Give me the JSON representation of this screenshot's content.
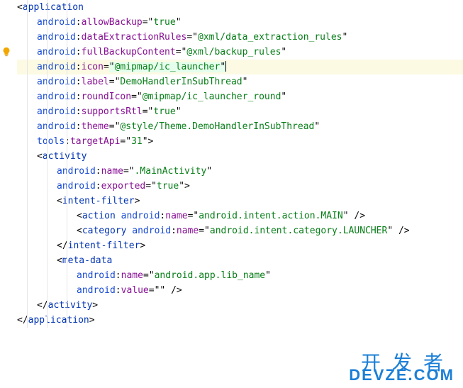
{
  "gutter": {
    "bulb_line_index": 3,
    "bulb_icon": "lightbulb-icon"
  },
  "highlighted_line_index": 3,
  "watermark": {
    "line1": "开发者",
    "line2": "DEVZE.COM"
  },
  "code_lines": [
    {
      "indent": 1,
      "tokens": [
        {
          "t": "punct",
          "v": "<"
        },
        {
          "t": "tag",
          "v": "application"
        }
      ]
    },
    {
      "indent": 2,
      "tokens": [
        {
          "t": "ns",
          "v": "android"
        },
        {
          "t": "punct",
          "v": ":"
        },
        {
          "t": "attr",
          "v": "allowBackup"
        },
        {
          "t": "punct",
          "v": "=\""
        },
        {
          "t": "str",
          "v": "true"
        },
        {
          "t": "punct",
          "v": "\""
        }
      ]
    },
    {
      "indent": 2,
      "tokens": [
        {
          "t": "ns",
          "v": "android"
        },
        {
          "t": "punct",
          "v": ":"
        },
        {
          "t": "attr",
          "v": "dataExtractionRules"
        },
        {
          "t": "punct",
          "v": "=\""
        },
        {
          "t": "str",
          "v": "@xml/data_extraction_rules"
        },
        {
          "t": "punct",
          "v": "\""
        }
      ]
    },
    {
      "indent": 2,
      "tokens": [
        {
          "t": "ns",
          "v": "android"
        },
        {
          "t": "punct",
          "v": ":"
        },
        {
          "t": "attr",
          "v": "fullBackupContent"
        },
        {
          "t": "punct",
          "v": "=\""
        },
        {
          "t": "str",
          "v": "@xml/backup_rules"
        },
        {
          "t": "punct",
          "v": "\""
        }
      ]
    },
    {
      "indent": 2,
      "highlight": true,
      "tokens": [
        {
          "t": "ns",
          "v": "android"
        },
        {
          "t": "punct",
          "v": ":"
        },
        {
          "t": "attr",
          "v": "icon"
        },
        {
          "t": "punct",
          "v": "="
        },
        {
          "t": "punct",
          "hl": true,
          "v": "\""
        },
        {
          "t": "str",
          "hl": true,
          "v": "@mipmap/ic_launcher"
        },
        {
          "t": "punct",
          "hl": true,
          "v": "\""
        },
        {
          "t": "caret",
          "v": ""
        }
      ]
    },
    {
      "indent": 2,
      "tokens": [
        {
          "t": "ns",
          "v": "android"
        },
        {
          "t": "punct",
          "v": ":"
        },
        {
          "t": "attr",
          "v": "label"
        },
        {
          "t": "punct",
          "v": "=\""
        },
        {
          "t": "str",
          "v": "DemoHandlerInSubThread"
        },
        {
          "t": "punct",
          "v": "\""
        }
      ]
    },
    {
      "indent": 2,
      "tokens": [
        {
          "t": "ns",
          "v": "android"
        },
        {
          "t": "punct",
          "v": ":"
        },
        {
          "t": "attr",
          "v": "roundIcon"
        },
        {
          "t": "punct",
          "v": "=\""
        },
        {
          "t": "str",
          "v": "@mipmap/ic_launcher_round"
        },
        {
          "t": "punct",
          "v": "\""
        }
      ]
    },
    {
      "indent": 2,
      "tokens": [
        {
          "t": "ns",
          "v": "android"
        },
        {
          "t": "punct",
          "v": ":"
        },
        {
          "t": "attr",
          "v": "supportsRtl"
        },
        {
          "t": "punct",
          "v": "=\""
        },
        {
          "t": "str",
          "v": "true"
        },
        {
          "t": "punct",
          "v": "\""
        }
      ]
    },
    {
      "indent": 2,
      "tokens": [
        {
          "t": "ns",
          "v": "android"
        },
        {
          "t": "punct",
          "v": ":"
        },
        {
          "t": "attr",
          "v": "theme"
        },
        {
          "t": "punct",
          "v": "=\""
        },
        {
          "t": "str",
          "v": "@style/Theme.DemoHandlerInSubThread"
        },
        {
          "t": "punct",
          "v": "\""
        }
      ]
    },
    {
      "indent": 2,
      "tokens": [
        {
          "t": "ns",
          "v": "tools"
        },
        {
          "t": "punct",
          "v": ":"
        },
        {
          "t": "attr",
          "v": "targetApi"
        },
        {
          "t": "punct",
          "v": "=\""
        },
        {
          "t": "str",
          "v": "31"
        },
        {
          "t": "punct",
          "v": "\">"
        }
      ]
    },
    {
      "indent": 2,
      "tokens": [
        {
          "t": "punct",
          "v": "<"
        },
        {
          "t": "tag",
          "v": "activity"
        }
      ]
    },
    {
      "indent": 3,
      "tokens": [
        {
          "t": "ns",
          "v": "android"
        },
        {
          "t": "punct",
          "v": ":"
        },
        {
          "t": "attr",
          "v": "name"
        },
        {
          "t": "punct",
          "v": "=\""
        },
        {
          "t": "str",
          "v": ".MainActivity"
        },
        {
          "t": "punct",
          "v": "\""
        }
      ]
    },
    {
      "indent": 3,
      "tokens": [
        {
          "t": "ns",
          "v": "android"
        },
        {
          "t": "punct",
          "v": ":"
        },
        {
          "t": "attr",
          "v": "exported"
        },
        {
          "t": "punct",
          "v": "=\""
        },
        {
          "t": "str",
          "v": "true"
        },
        {
          "t": "punct",
          "v": "\">"
        }
      ]
    },
    {
      "indent": 3,
      "tokens": [
        {
          "t": "punct",
          "v": "<"
        },
        {
          "t": "tag",
          "v": "intent-filter"
        },
        {
          "t": "punct",
          "v": ">"
        }
      ]
    },
    {
      "indent": 4,
      "tokens": [
        {
          "t": "punct",
          "v": "<"
        },
        {
          "t": "tag",
          "v": "action"
        },
        {
          "t": "punct",
          "v": " "
        },
        {
          "t": "ns",
          "v": "android"
        },
        {
          "t": "punct",
          "v": ":"
        },
        {
          "t": "attr",
          "v": "name"
        },
        {
          "t": "punct",
          "v": "=\""
        },
        {
          "t": "str",
          "v": "android.intent.action.MAIN"
        },
        {
          "t": "punct",
          "v": "\" />"
        }
      ]
    },
    {
      "indent": 4,
      "tokens": [
        {
          "t": "punct",
          "v": ""
        }
      ]
    },
    {
      "indent": 4,
      "tokens": [
        {
          "t": "punct",
          "v": "<"
        },
        {
          "t": "tag",
          "v": "category"
        },
        {
          "t": "punct",
          "v": " "
        },
        {
          "t": "ns",
          "v": "android"
        },
        {
          "t": "punct",
          "v": ":"
        },
        {
          "t": "attr",
          "v": "name"
        },
        {
          "t": "punct",
          "v": "=\""
        },
        {
          "t": "str",
          "v": "android.intent.category.LAUNCHER"
        },
        {
          "t": "punct",
          "v": "\" />"
        }
      ]
    },
    {
      "indent": 3,
      "tokens": [
        {
          "t": "punct",
          "v": "</"
        },
        {
          "t": "tag",
          "v": "intent-filter"
        },
        {
          "t": "punct",
          "v": ">"
        }
      ]
    },
    {
      "indent": 3,
      "tokens": [
        {
          "t": "punct",
          "v": ""
        }
      ]
    },
    {
      "indent": 3,
      "tokens": [
        {
          "t": "punct",
          "v": "<"
        },
        {
          "t": "tag",
          "v": "meta-data"
        }
      ]
    },
    {
      "indent": 4,
      "tokens": [
        {
          "t": "ns",
          "v": "android"
        },
        {
          "t": "punct",
          "v": ":"
        },
        {
          "t": "attr",
          "v": "name"
        },
        {
          "t": "punct",
          "v": "=\""
        },
        {
          "t": "str",
          "v": "android.app.lib_name"
        },
        {
          "t": "punct",
          "v": "\""
        }
      ]
    },
    {
      "indent": 4,
      "tokens": [
        {
          "t": "ns",
          "v": "android"
        },
        {
          "t": "punct",
          "v": ":"
        },
        {
          "t": "attr",
          "v": "value"
        },
        {
          "t": "punct",
          "v": "=\""
        },
        {
          "t": "str",
          "v": ""
        },
        {
          "t": "punct",
          "v": "\" />"
        }
      ]
    },
    {
      "indent": 2,
      "tokens": [
        {
          "t": "punct",
          "v": "</"
        },
        {
          "t": "tag",
          "v": "activity"
        },
        {
          "t": "punct",
          "v": ">"
        }
      ]
    },
    {
      "indent": 1,
      "tokens": [
        {
          "t": "punct",
          "v": "</"
        },
        {
          "t": "tag",
          "v": "application"
        },
        {
          "t": "punct",
          "v": ">"
        }
      ]
    }
  ]
}
